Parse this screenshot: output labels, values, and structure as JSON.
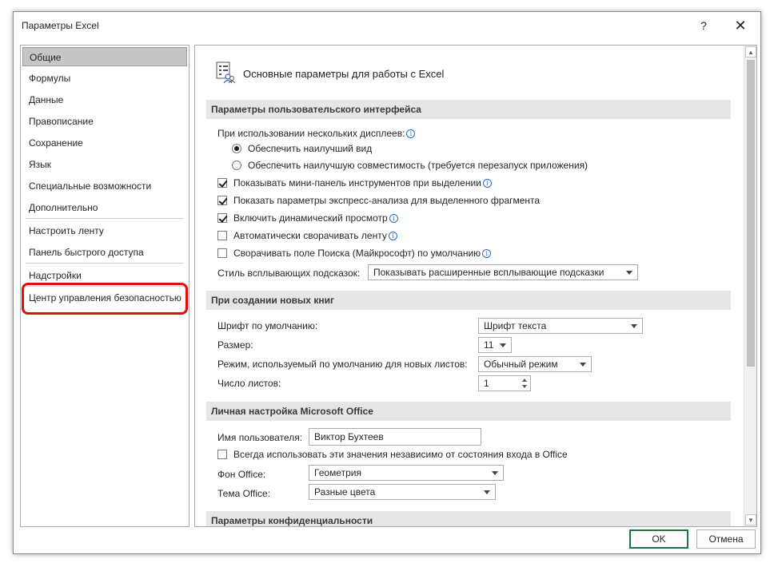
{
  "window": {
    "title": "Параметры Excel",
    "help": "?",
    "close": "✕"
  },
  "nav": {
    "items": [
      {
        "label": "Общие",
        "selected": true
      },
      {
        "label": "Формулы"
      },
      {
        "label": "Данные"
      },
      {
        "label": "Правописание"
      },
      {
        "label": "Сохранение"
      },
      {
        "label": "Язык"
      },
      {
        "label": "Специальные возможности"
      },
      {
        "label": "Дополнительно"
      },
      {
        "label": "Настроить ленту"
      },
      {
        "label": "Панель быстрого доступа"
      },
      {
        "label": "Надстройки"
      },
      {
        "label": "Центр управления безопасностью",
        "highlighted": true
      }
    ],
    "highlight_color": "#e30b0b"
  },
  "content": {
    "header": "Основные параметры для работы с Excel",
    "sections": {
      "ui": "Параметры пользовательского интерфейса",
      "new_books": "При создании новых книг",
      "personal": "Личная настройка Microsoft Office",
      "privacy": "Параметры конфиденциальности"
    },
    "ui": {
      "multi_display_label": "При использовании нескольких дисплеев:",
      "radio_best_view": "Обеспечить наилучший вид",
      "radio_best_view_checked": true,
      "radio_compat": "Обеспечить наилучшую совместимость (требуется перезапуск приложения)",
      "radio_compat_checked": false,
      "cb_minitoolbar": "Показывать мини-панель инструментов при выделении",
      "cb_minitoolbar_checked": true,
      "cb_quick_analysis": "Показать параметры экспресс-анализа для выделенного фрагмента",
      "cb_quick_analysis_checked": true,
      "cb_live_preview": "Включить динамический просмотр",
      "cb_live_preview_checked": true,
      "cb_collapse_ribbon": "Автоматически сворачивать ленту",
      "cb_collapse_ribbon_checked": false,
      "cb_collapse_search": "Сворачивать поле Поиска (Майкрософт) по умолчанию",
      "cb_collapse_search_checked": false,
      "tooltip_style_label": "Стиль всплывающих подсказок:",
      "tooltip_style_value": "Показывать расширенные всплывающие подсказки"
    },
    "new_books": {
      "font_label": "Шрифт по умолчанию:",
      "font_value": "Шрифт текста",
      "size_label": "Размер:",
      "size_value": "11",
      "view_label": "Режим, используемый по умолчанию для новых листов:",
      "view_value": "Обычный режим",
      "sheets_label": "Число листов:",
      "sheets_value": "1"
    },
    "personal": {
      "username_label": "Имя пользователя:",
      "username_value": "Виктор Бухтеев",
      "cb_always_use": "Всегда использовать эти значения независимо от состояния входа в Office",
      "cb_always_use_checked": false,
      "background_label": "Фон Office:",
      "background_value": "Геометрия",
      "theme_label": "Тема Office:",
      "theme_value": "Разные цвета"
    }
  },
  "buttons": {
    "ok": "OK",
    "cancel": "Отмена"
  }
}
